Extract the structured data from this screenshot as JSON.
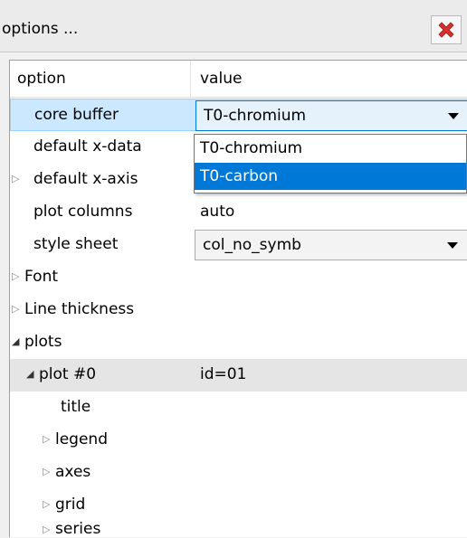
{
  "window": {
    "title": "options ...",
    "close_icon": "close-icon"
  },
  "table": {
    "headers": {
      "option": "option",
      "value": "value"
    },
    "rows": [
      {
        "label": "core buffer",
        "value": "T0-chromium",
        "expander": "none"
      },
      {
        "label": "default x-data",
        "value": "",
        "expander": "none"
      },
      {
        "label": "default x-axis",
        "value": "",
        "expander": "collapsed"
      },
      {
        "label": "plot columns",
        "value": "auto",
        "expander": "none"
      },
      {
        "label": "style sheet",
        "value": "col_no_symb",
        "expander": "none"
      },
      {
        "label": "Font",
        "value": "",
        "expander": "collapsed"
      },
      {
        "label": "Line thickness",
        "value": "",
        "expander": "collapsed"
      },
      {
        "label": "plots",
        "value": "",
        "expander": "expanded"
      },
      {
        "label": "plot #0",
        "value": "id=01",
        "expander": "expanded"
      },
      {
        "label": "title",
        "value": "",
        "expander": "none"
      },
      {
        "label": "legend",
        "value": "",
        "expander": "collapsed"
      },
      {
        "label": "axes",
        "value": "",
        "expander": "collapsed"
      },
      {
        "label": "grid",
        "value": "",
        "expander": "collapsed"
      },
      {
        "label": "series",
        "value": "",
        "expander": "collapsed"
      }
    ]
  },
  "dropdown": {
    "options": [
      "T0-chromium",
      "T0-carbon"
    ],
    "highlighted": "T0-carbon"
  },
  "colors": {
    "selection": "#0078d7",
    "row_selected": "#cce8ff",
    "close_red": "#d9302c"
  }
}
